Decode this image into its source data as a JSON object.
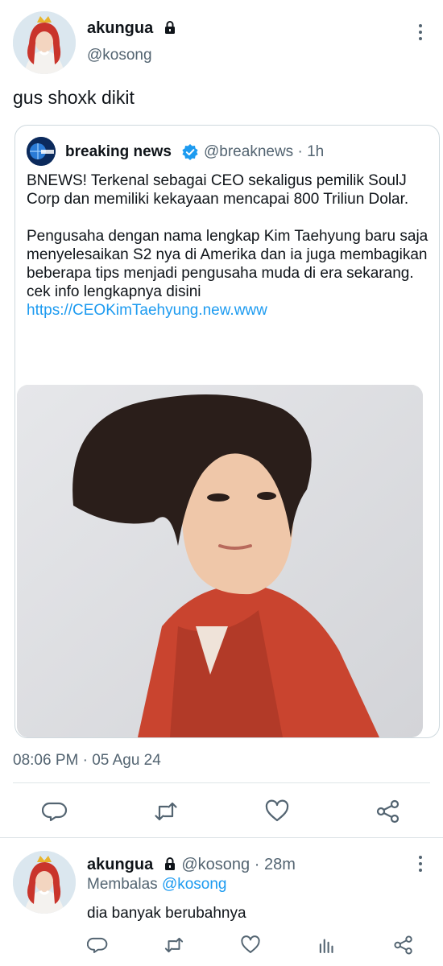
{
  "tweet": {
    "author_name": "akungua",
    "author_handle": "@kosong",
    "text": "gus shoxk dikit",
    "timestamp": "08:06 PM · 05 Agu 24"
  },
  "quote": {
    "author_name": "breaking news",
    "author_handle": "@breaknews",
    "time": "1h",
    "paragraph1": "BNEWS! Terkenal sebagai CEO sekaligus pemilik SoulJ Corp dan memiliki kekayaan mencapai 800 Triliun Dolar.",
    "paragraph2": "Pengusaha dengan nama lengkap Kim Taehyung baru saja menyelesaikan S2 nya di Amerika dan ia juga membagikan beberapa tips menjadi pengusaha muda di era sekarang.",
    "link_prefix": "cek info lengkapnya disini",
    "link_text": "https://CEOKimTaehyung.new.www"
  },
  "reply": {
    "author_name": "akungua",
    "author_handle": "@kosong",
    "time": "28m",
    "context_prefix": "Membalas",
    "context_mention": "@kosong",
    "text": "dia banyak berubahnya"
  },
  "icons": {
    "accent": "#1d9bf0",
    "muted": "#536471",
    "action_icons": [
      "reply-icon",
      "retweet-icon",
      "like-icon",
      "share-icon"
    ],
    "reply_action_icons": [
      "reply-icon",
      "retweet-icon",
      "like-icon",
      "analytics-icon",
      "share-icon"
    ]
  }
}
